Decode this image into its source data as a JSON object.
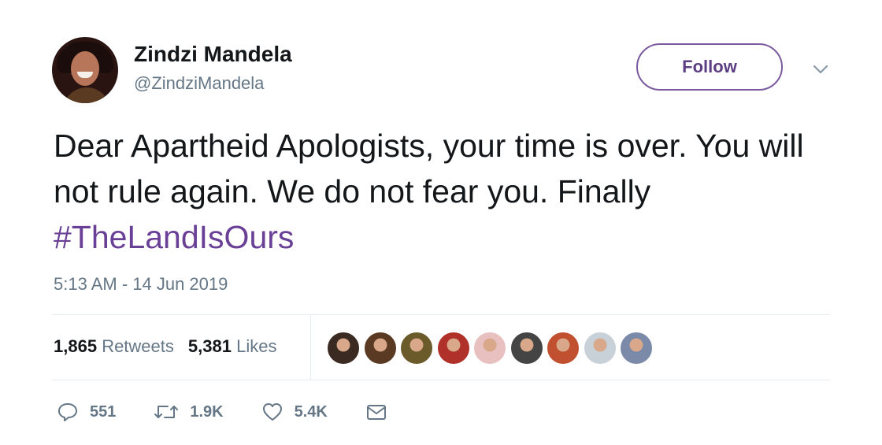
{
  "user": {
    "name": "Zindzi Mandela",
    "handle": "@ZindziMandela"
  },
  "follow_button": {
    "label": "Follow"
  },
  "tweet": {
    "text_plain": "Dear Apartheid Apologists, your time is over. You will not rule again. We do not fear you. Finally",
    "hashtag": "#TheLandIsOurs",
    "timestamp": "5:13 AM - 14 Jun 2019"
  },
  "stats": {
    "retweets_count": "1,865",
    "retweets_label": "Retweets",
    "likes_count": "5,381",
    "likes_label": "Likes"
  },
  "liker_avatars": [
    "#3a2a22",
    "#5a3a22",
    "#6b5a2a",
    "#b0302a",
    "#e8c0c0",
    "#444444",
    "#c05030",
    "#c8d0d8",
    "#7a8aa8"
  ],
  "actions": {
    "reply_count": "551",
    "retweet_count": "1.9K",
    "like_count": "5.4K"
  },
  "colors": {
    "accent": "#6a3f96",
    "follow_border": "#7b5a9e",
    "secondary_text": "#657786"
  },
  "icons": {
    "reply": "reply-icon",
    "retweet": "retweet-icon",
    "like": "heart-icon",
    "dm": "envelope-icon",
    "menu": "chevron-down-icon"
  }
}
